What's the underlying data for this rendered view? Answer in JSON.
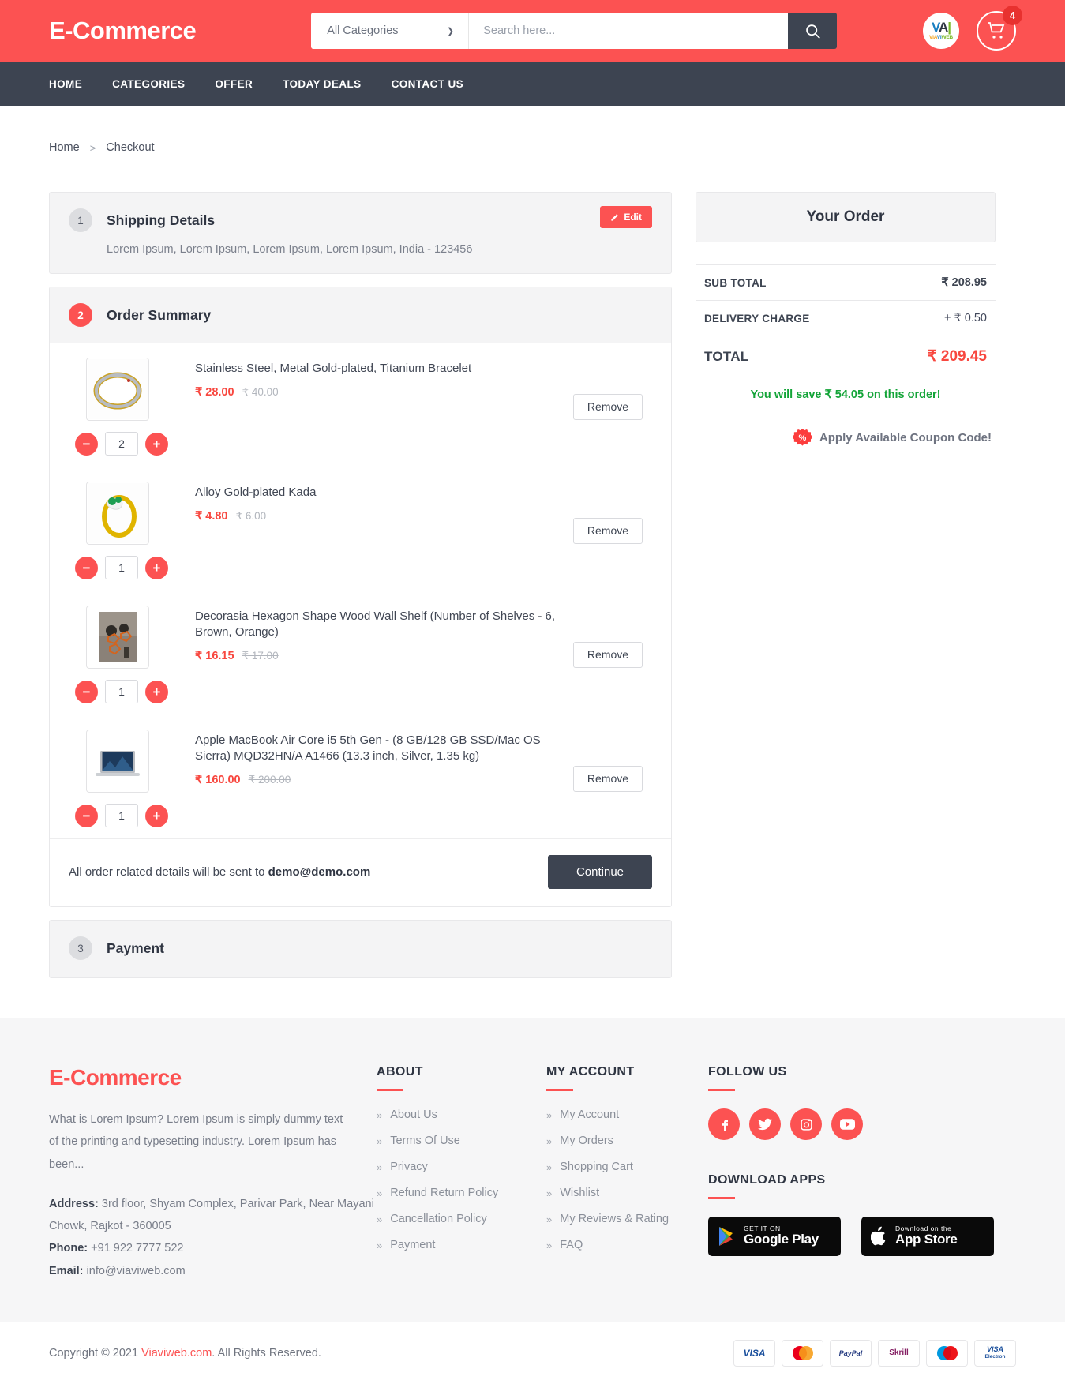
{
  "header": {
    "brand": "E-Commerce",
    "category_select": "All Categories",
    "search_placeholder": "Search here...",
    "search_value": "",
    "search_icon": "search-icon",
    "partner_logo_main": "VA",
    "partner_logo_sub": "VIAVIWEB",
    "cart_count": "4",
    "accent_color": "#fc5252",
    "dark_color": "#3d4451"
  },
  "nav": {
    "items": [
      {
        "label": "HOME"
      },
      {
        "label": "CATEGORIES"
      },
      {
        "label": "OFFER"
      },
      {
        "label": "TODAY DEALS"
      },
      {
        "label": "CONTACT US"
      }
    ]
  },
  "breadcrumb": {
    "home": "Home",
    "separator": ">",
    "current": "Checkout"
  },
  "checkout": {
    "step1": {
      "number": "1",
      "title": "Shipping Details",
      "address": "Lorem Ipsum, Lorem Ipsum, Lorem Ipsum, Lorem Ipsum, India - 123456",
      "edit_label": "Edit"
    },
    "step2": {
      "number": "2",
      "title": "Order Summary",
      "remove_label": "Remove",
      "items": [
        {
          "name": "Stainless Steel, Metal Gold-plated, Titanium Bracelet",
          "price": "₹ 28.00",
          "old_price": "₹ 40.00",
          "qty": "2",
          "image": "bracelet-thumbnail"
        },
        {
          "name": "Alloy Gold-plated Kada",
          "price": "₹ 4.80",
          "old_price": "₹ 6.00",
          "qty": "1",
          "image": "kada-thumbnail"
        },
        {
          "name": "Decorasia Hexagon Shape Wood Wall Shelf (Number of Shelves - 6, Brown, Orange)",
          "price": "₹ 16.15",
          "old_price": "₹ 17.00",
          "qty": "1",
          "image": "wall-shelf-thumbnail"
        },
        {
          "name": "Apple MacBook Air Core i5 5th Gen - (8 GB/128 GB SSD/Mac OS Sierra) MQD32HN/A A1466 (13.3 inch, Silver, 1.35 kg)",
          "price": "₹ 160.00",
          "old_price": "₹ 200.00",
          "qty": "1",
          "image": "macbook-thumbnail"
        }
      ],
      "email_note_prefix": "All order related details will be sent to ",
      "email": "demo@demo.com",
      "continue_label": "Continue"
    },
    "step3": {
      "number": "3",
      "title": "Payment"
    }
  },
  "order": {
    "title": "Your Order",
    "rows": [
      {
        "label": "SUB TOTAL",
        "value": "₹ 208.95"
      },
      {
        "label": "DELIVERY CHARGE",
        "value": "+ ₹ 0.50"
      }
    ],
    "total_label": "TOTAL",
    "total_value": "₹ 209.45",
    "save_note": "You will save ₹ 54.05 on this order!",
    "coupon_label": "Apply Available Coupon Code!",
    "coupon_icon": "percent-badge-icon",
    "total_color": "#f8473f",
    "save_color": "#13a438"
  },
  "footer": {
    "brand": "E-Commerce",
    "description": "What is Lorem Ipsum? Lorem Ipsum is simply dummy text of the printing and typesetting industry. Lorem Ipsum has been...",
    "address_label": "Address:",
    "address_value": "3rd floor, Shyam Complex, Parivar Park, Near Mayani Chowk, Rajkot - 360005",
    "phone_label": "Phone:",
    "phone_value": "+91 922 7777 522",
    "email_label": "Email:",
    "email_value": "info@viaviweb.com",
    "about": {
      "heading": "ABOUT",
      "links": [
        {
          "label": "About Us"
        },
        {
          "label": "Terms Of Use"
        },
        {
          "label": "Privacy"
        },
        {
          "label": "Refund Return Policy"
        },
        {
          "label": "Cancellation Policy"
        },
        {
          "label": "Payment"
        }
      ]
    },
    "account": {
      "heading": "MY ACCOUNT",
      "links": [
        {
          "label": "My Account"
        },
        {
          "label": "My Orders"
        },
        {
          "label": "Shopping Cart"
        },
        {
          "label": "Wishlist"
        },
        {
          "label": "My Reviews & Rating"
        },
        {
          "label": "FAQ"
        }
      ]
    },
    "follow": {
      "heading": "FOLLOW US",
      "socials": [
        {
          "name": "facebook-icon",
          "glyph": "f"
        },
        {
          "name": "twitter-icon",
          "glyph": "t"
        },
        {
          "name": "instagram-icon",
          "glyph": "i"
        },
        {
          "name": "youtube-icon",
          "glyph": "y"
        }
      ]
    },
    "apps": {
      "heading": "DOWNLOAD APPS",
      "google": {
        "line1": "GET IT ON",
        "line2": "Google Play"
      },
      "apple": {
        "line1": "Download on the",
        "line2": "App Store"
      }
    }
  },
  "bottom": {
    "copyright_prefix": "Copyright © 2021 ",
    "copyright_link": "Viaviweb.com",
    "copyright_suffix": ". All Rights Reserved.",
    "cards": [
      {
        "name": "visa-card-logo",
        "label": "VISA"
      },
      {
        "name": "mastercard-logo",
        "label": "MasterCard"
      },
      {
        "name": "paypal-logo",
        "label": "PayPal"
      },
      {
        "name": "skrill-logo",
        "label": "Skrill"
      },
      {
        "name": "maestro-logo",
        "label": "Maestro"
      },
      {
        "name": "visa-electron-logo",
        "label": "VISA Electron"
      }
    ]
  }
}
